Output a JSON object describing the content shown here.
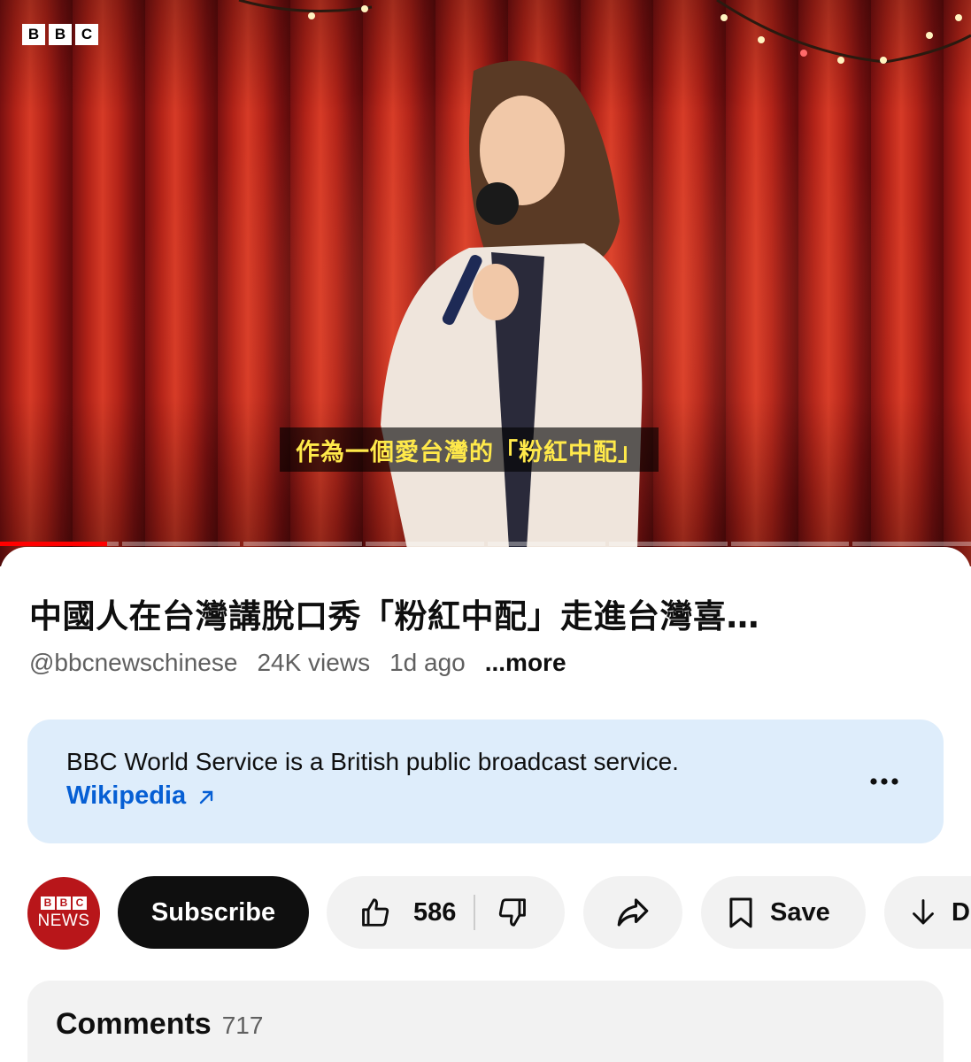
{
  "video": {
    "channel_logo_letters": [
      "B",
      "B",
      "C"
    ],
    "subtitle": "作為一個愛台灣的「粉紅中配」",
    "progress_fraction": 0.11
  },
  "title": "中國人在台灣講脫口秀「粉紅中配」走進台灣喜…",
  "meta": {
    "handle": "@bbcnewschinese",
    "views": "24K views",
    "age": "1d ago",
    "more": "...more"
  },
  "info_card": {
    "text": "BBC World Service is a British public broadcast service.",
    "link": "Wikipedia",
    "menu_icon": "more-horizontal-icon"
  },
  "actions": {
    "avatar": {
      "letters": [
        "B",
        "B",
        "C"
      ],
      "label": "NEWS",
      "color": "#b8161a"
    },
    "subscribe": "Subscribe",
    "like_count": "586",
    "save": "Save",
    "download": "D",
    "icons": [
      "thumbs-up-icon",
      "thumbs-down-icon",
      "share-icon",
      "bookmark-icon",
      "download-icon"
    ]
  },
  "comments": {
    "title": "Comments",
    "count": "717"
  },
  "colors": {
    "accent_red": "#ff0000",
    "link_blue": "#065fd4",
    "info_bg": "#deedfb",
    "subtitle_yellow": "#ffe94a"
  }
}
